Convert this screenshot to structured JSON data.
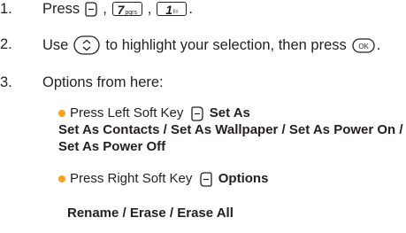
{
  "steps": [
    {
      "num": "1.",
      "text": "Press",
      "sep1": ",",
      "sep2": ",",
      "end": "."
    },
    {
      "num": "2.",
      "text_a": "Use",
      "text_b": "to highlight your selection, then press",
      "end": "."
    },
    {
      "num": "3.",
      "text": "Options from here:"
    }
  ],
  "keys": {
    "key7_main": "7",
    "key7_sub": "pqrs",
    "key1_main": "1",
    "key1_sub": "ᴱᵒ",
    "ok_label": "OK"
  },
  "left_option": {
    "prefix": "Press Left Soft Key",
    "name": "Set As",
    "line1": "Set As Contacts / Set As Wallpaper / Set As Power On /",
    "line2": "Set As Power Off"
  },
  "right_option": {
    "prefix": "Press Right Soft Key",
    "name": "Options",
    "line1": "Rename / Erase / Erase All"
  },
  "colors": {
    "bullet": "#f5a31a",
    "text": "#231f20"
  },
  "icons": [
    "left-softkey-icon",
    "navigation-key-icon",
    "ok-key-icon",
    "right-softkey-icon"
  ]
}
